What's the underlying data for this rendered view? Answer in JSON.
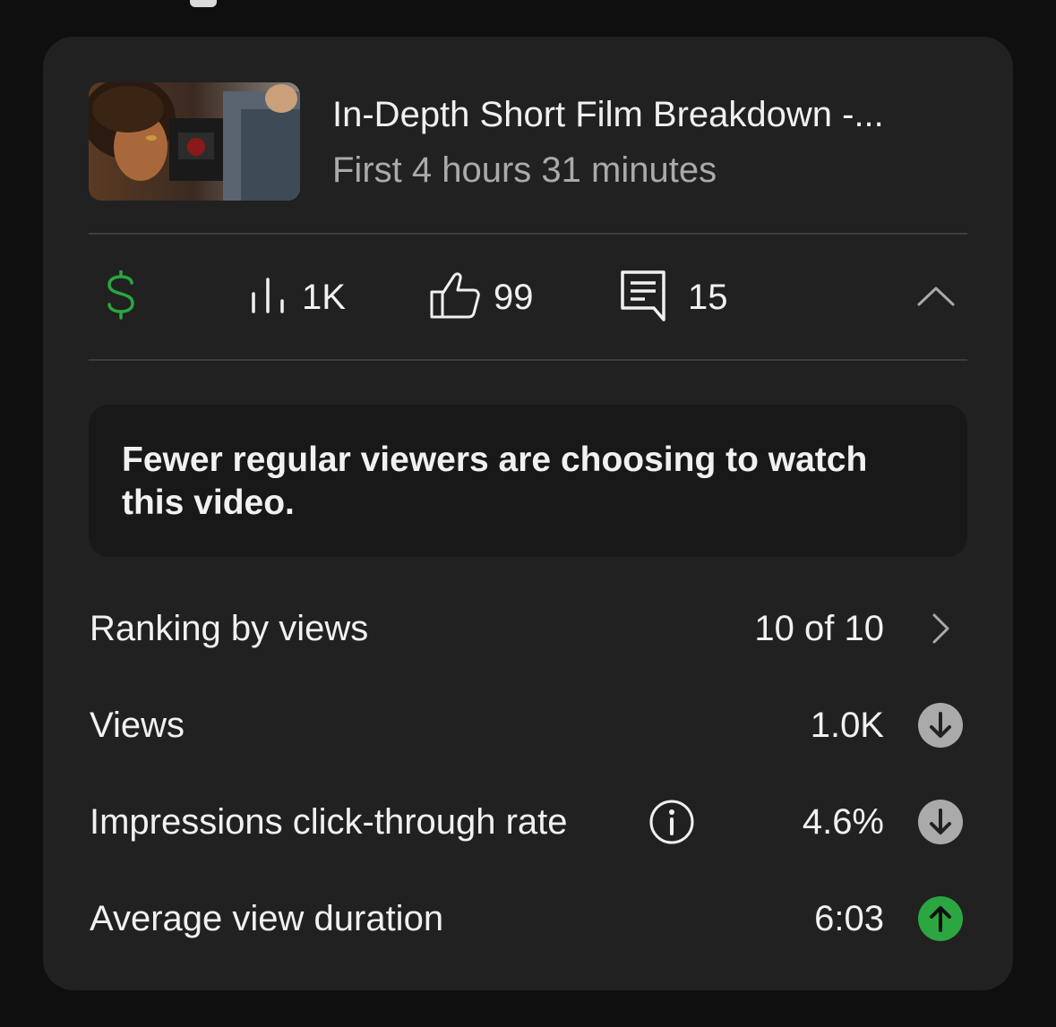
{
  "video": {
    "title": "In-Depth Short Film Breakdown -...",
    "subtitle": "First 4 hours 31 minutes",
    "thumbnail_icon": "video-thumbnail"
  },
  "stats": {
    "revenue_icon": "dollar-icon",
    "views_icon": "bar-chart-icon",
    "views": "1K",
    "likes_icon": "thumbs-up-icon",
    "likes": "99",
    "comments_icon": "comment-icon",
    "comments": "15",
    "collapse_icon": "chevron-up-icon"
  },
  "notice": {
    "text": "Fewer regular viewers are choosing to watch this video."
  },
  "metrics": [
    {
      "label": "Ranking by views",
      "value": "10 of 10",
      "icon": "chevron-right-icon"
    },
    {
      "label": "Views",
      "value": "1.0K",
      "icon": "arrow-down-circle-icon",
      "trend": "down"
    },
    {
      "label": "Impressions click-through rate",
      "value": "4.6%",
      "icon": "arrow-down-circle-icon",
      "trend": "down",
      "info_icon": "info-icon"
    },
    {
      "label": "Average view duration",
      "value": "6:03",
      "icon": "arrow-up-circle-icon",
      "trend": "up"
    }
  ],
  "colors": {
    "background": "#0f0f0f",
    "card": "#212121",
    "notice": "#181818",
    "revenue_green": "#2ba640",
    "trend_down": "#aaaaaa",
    "trend_up": "#2ba640"
  }
}
